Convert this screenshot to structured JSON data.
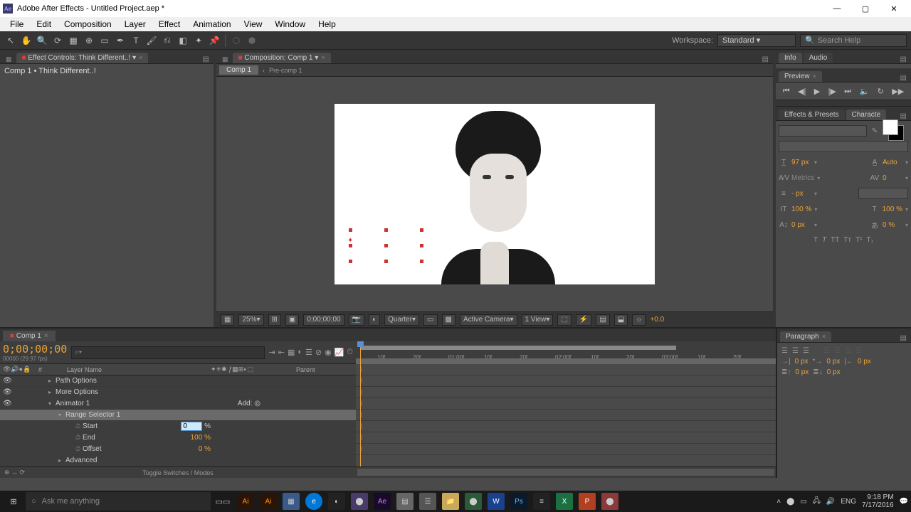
{
  "window": {
    "app_icon": "Ae",
    "title": "Adobe After Effects - Untitled Project.aep *",
    "min": "—",
    "max": "▢",
    "close": "✕"
  },
  "menu": [
    "File",
    "Edit",
    "Composition",
    "Layer",
    "Effect",
    "Animation",
    "View",
    "Window",
    "Help"
  ],
  "workspace": {
    "label": "Workspace:",
    "value": "Standard",
    "search_ph": "Search Help"
  },
  "effect_controls": {
    "tab": "Effect Controls: Think  Different..!",
    "breadcrumb": "Comp 1 • Think  Different..!"
  },
  "comp_panel": {
    "tab": "Composition: Comp 1",
    "crumb_active": "Comp 1",
    "crumb_sep": "‹",
    "crumb_next": "Pre-comp 1"
  },
  "viewer_bar": {
    "mag": "25%",
    "time": "0;00;00;00",
    "res": "Quarter",
    "camera": "Active Camera",
    "views": "1 View",
    "exposure": "+0.0"
  },
  "info_panel": {
    "tab_info": "Info",
    "tab_audio": "Audio"
  },
  "preview_panel": {
    "tab": "Preview"
  },
  "ep_char": {
    "tab_ep": "Effects & Presets",
    "tab_char": "Characte"
  },
  "character": {
    "font_size": "97",
    "font_size_unit": "px",
    "leading": "Auto",
    "kerning": "Metrics",
    "tracking": "0",
    "stroke": "-",
    "stroke_unit": "px",
    "vscale": "100",
    "vscale_unit": "%",
    "hscale": "100",
    "hscale_unit": "%",
    "baseline": "0",
    "baseline_unit": "px",
    "tsume": "0",
    "tsume_unit": "%"
  },
  "timeline": {
    "tab": "Comp 1",
    "timecode": "0;00;00;00",
    "timecode_sub": "00000 (29.97 fps)",
    "search_ph": "⌕▾",
    "col_hash": "#",
    "col_layer": "Layer Name",
    "col_parent": "Parent",
    "rows": [
      {
        "indent": 1,
        "tw": "▸",
        "name": "Path Options"
      },
      {
        "indent": 1,
        "tw": "▸",
        "name": "More Options"
      },
      {
        "indent": 1,
        "tw": "▾",
        "name": "Animator 1",
        "add": "Add: ◎"
      },
      {
        "indent": 2,
        "tw": "▾",
        "name": "Range Selector 1",
        "sel": true
      },
      {
        "indent": 3,
        "stop": true,
        "name": "Start",
        "value_input": "0",
        "unit": "%"
      },
      {
        "indent": 3,
        "stop": true,
        "name": "End",
        "value": "100",
        "unit": "%"
      },
      {
        "indent": 3,
        "stop": true,
        "name": "Offset",
        "value": "0",
        "unit": "%"
      },
      {
        "indent": 2,
        "tw": "▸",
        "name": "Advanced"
      }
    ],
    "toggle": "Toggle Switches / Modes",
    "ruler": [
      "10f",
      "20f",
      "01:00f",
      "10f",
      "20f",
      "02:00f",
      "10f",
      "20f",
      "03:00f",
      "10f",
      "20f"
    ]
  },
  "paragraph": {
    "tab": "Paragraph",
    "indent_left": "0",
    "indent_right": "0",
    "indent_first": "0",
    "space_before": "0",
    "space_after": "0",
    "unit": "px"
  },
  "taskbar": {
    "cortana": "Ask me anything",
    "time": "9:18 PM",
    "date": "7/17/2016",
    "lang": "ENG"
  }
}
